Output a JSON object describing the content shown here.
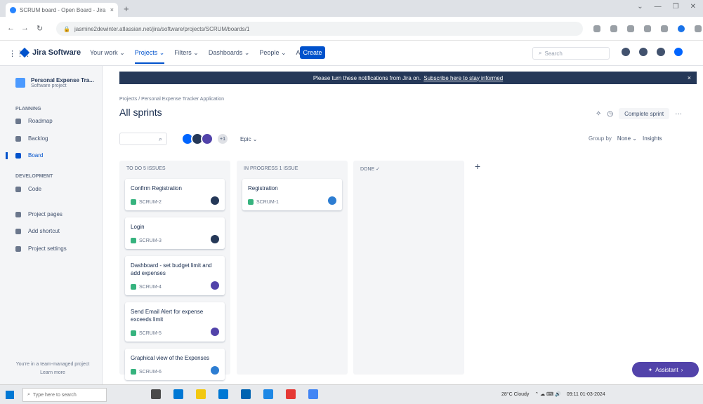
{
  "browser": {
    "tab_title": "SCRUM board - Open Board - Jira",
    "tab_close": "×",
    "new_tab": "+",
    "window_controls": [
      "⌄",
      "—",
      "❐",
      "✕"
    ],
    "nav": {
      "back": "←",
      "forward": "→",
      "reload": "↻"
    },
    "url": "jasmine2dewinter.atlassian.net/jira/software/projects/SCRUM/boards/1"
  },
  "jira": {
    "grid": "⋮⋮⋮",
    "product": "Jira Software",
    "nav": [
      "Your work ⌄",
      "Projects ⌄",
      "Filters ⌄",
      "Dashboards ⌄",
      "People ⌄",
      "Apps ⌄"
    ],
    "create": "Create",
    "search_placeholder": "Search"
  },
  "sidebar": {
    "project_name": "Personal Expense Tra...",
    "project_type": "Software project",
    "planning_heading": "PLANNING",
    "planning_items": [
      "Roadmap",
      "Backlog",
      "Board"
    ],
    "development_heading": "DEVELOPMENT",
    "development_items": [
      "Code"
    ],
    "other_items": [
      "Project pages",
      "Add shortcut",
      "Project settings"
    ],
    "footer": "You're in a team-managed project Learn more"
  },
  "banner": {
    "text": "Please turn these notifications from Jira on.",
    "link": "Subscribe here to stay informed",
    "close": "×"
  },
  "header": {
    "breadcrumb": "Projects / Personal Expense Tracker Application",
    "title": "All sprints",
    "complete_sprint": "Complete sprint",
    "more": "···"
  },
  "filters": {
    "search_icon": "⌕",
    "more_avatars": "+1",
    "epic": "Epic ⌄",
    "group_by_label": "Group by",
    "group_by_value": "None ⌄",
    "insights": "Insights"
  },
  "columns": [
    {
      "title": "TO DO 5 ISSUES",
      "cards": [
        {
          "title": "Confirm Registration",
          "key": "SCRUM-2",
          "avatar_color": "#253858"
        },
        {
          "title": "Login",
          "key": "SCRUM-3",
          "avatar_color": "#253858"
        },
        {
          "title": "Dashboard - set budget limit and add expenses",
          "key": "SCRUM-4",
          "avatar_color": "#5243aa"
        },
        {
          "title": "Send Email Alert for expense exceeds limit",
          "key": "SCRUM-5",
          "avatar_color": "#5243aa"
        },
        {
          "title": "Graphical view of the Expenses",
          "key": "SCRUM-6",
          "avatar_color": "#2d7dd2"
        }
      ]
    },
    {
      "title": "IN PROGRESS 1 ISSUE",
      "cards": [
        {
          "title": "Registration",
          "key": "SCRUM-1",
          "avatar_color": "#2d7dd2"
        }
      ]
    },
    {
      "title": "DONE ✓",
      "cards": []
    }
  ],
  "assistant": "Assistant",
  "taskbar": {
    "search_placeholder": "Type here to search",
    "tray_text": "28°C Cloudy",
    "time": "09:11",
    "date": "01-03-2024"
  },
  "colors": {
    "primary": "#0052cc",
    "banner": "#253858",
    "assistant": "#5243aa",
    "done_check": "#36b37e"
  }
}
